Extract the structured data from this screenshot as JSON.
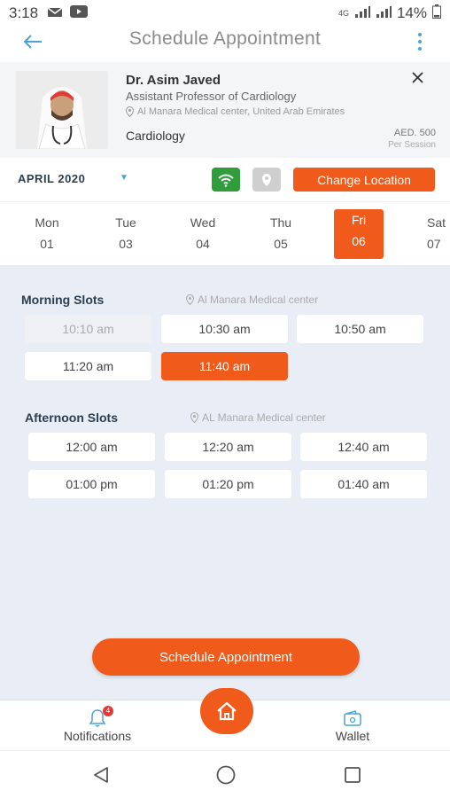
{
  "status_bar": {
    "time": "3:18",
    "battery": "14%",
    "network": "4G"
  },
  "header": {
    "title": "Schedule Appointment"
  },
  "doctor": {
    "name": "Dr. Asim Javed",
    "title": "Assistant Professor of Cardiology",
    "location": "Al Manara Medical center, United Arab Emirates",
    "specialty": "Cardiology",
    "fee": "AED. 500",
    "fee_unit": "Per Session"
  },
  "month": {
    "label": "APRIL 2020"
  },
  "change_location_label": "Change Location",
  "days": [
    {
      "name": "Mon",
      "date": "01",
      "selected": false
    },
    {
      "name": "Tue",
      "date": "03",
      "selected": false
    },
    {
      "name": "Wed",
      "date": "04",
      "selected": false
    },
    {
      "name": "Thu",
      "date": "05",
      "selected": false
    },
    {
      "name": "Fri",
      "date": "06",
      "selected": true
    },
    {
      "name": "Sat",
      "date": "07",
      "selected": false
    }
  ],
  "morning": {
    "title": "Morning Slots",
    "location": "Al Manara Medical center",
    "slots": [
      {
        "time": "10:10 am",
        "state": "disabled"
      },
      {
        "time": "10:30 am",
        "state": "available"
      },
      {
        "time": "10:50 am",
        "state": "available"
      },
      {
        "time": "11:20 am",
        "state": "available"
      },
      {
        "time": "11:40 am",
        "state": "selected"
      }
    ]
  },
  "afternoon": {
    "title": "Afternoon Slots",
    "location": "AL Manara Medical center",
    "slots": [
      {
        "time": "12:00 am",
        "state": "available"
      },
      {
        "time": "12:20 am",
        "state": "available"
      },
      {
        "time": "12:40 am",
        "state": "available"
      },
      {
        "time": "01:00 pm",
        "state": "available"
      },
      {
        "time": "01:20 pm",
        "state": "available"
      },
      {
        "time": "01:40 am",
        "state": "available"
      }
    ]
  },
  "schedule_button": "Schedule Appointment",
  "bottom_nav": {
    "notifications": "Notifications",
    "wallet": "Wallet",
    "badge": "4"
  },
  "colors": {
    "accent": "#f05a1a",
    "slot_bg": "#e8edf6",
    "online_green": "#2e9d3a",
    "link_blue": "#4aa3d6"
  }
}
